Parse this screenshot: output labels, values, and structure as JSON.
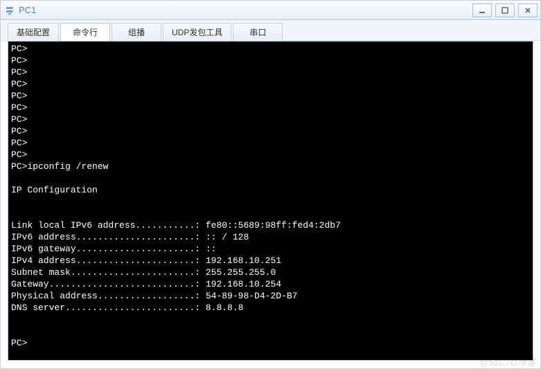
{
  "window": {
    "title": "PC1"
  },
  "tabs": [
    {
      "label": "基础配置",
      "active": false
    },
    {
      "label": "命令行",
      "active": true
    },
    {
      "label": "组播",
      "active": false
    },
    {
      "label": "UDP发包工具",
      "active": false
    },
    {
      "label": "串口",
      "active": false
    }
  ],
  "terminal": {
    "prompt": "PC>",
    "empty_prompt_count": 10,
    "command": "ipconfig /renew",
    "header": "IP Configuration",
    "rows": [
      {
        "label": "Link local IPv6 address",
        "dots": "...........",
        "value": "fe80::5689:98ff:fed4:2db7"
      },
      {
        "label": "IPv6 address",
        "dots": "......................",
        "value": ":: / 128"
      },
      {
        "label": "IPv6 gateway",
        "dots": "......................",
        "value": "::"
      },
      {
        "label": "IPv4 address",
        "dots": "......................",
        "value": "192.168.10.251"
      },
      {
        "label": "Subnet mask",
        "dots": ".......................",
        "value": "255.255.255.0"
      },
      {
        "label": "Gateway",
        "dots": "...........................",
        "value": "192.168.10.254"
      },
      {
        "label": "Physical address",
        "dots": "..................",
        "value": "54-89-98-D4-2D-B7"
      },
      {
        "label": "DNS server",
        "dots": "........................",
        "value": "8.8.8.8"
      }
    ]
  },
  "watermark": "@51CTO博客"
}
